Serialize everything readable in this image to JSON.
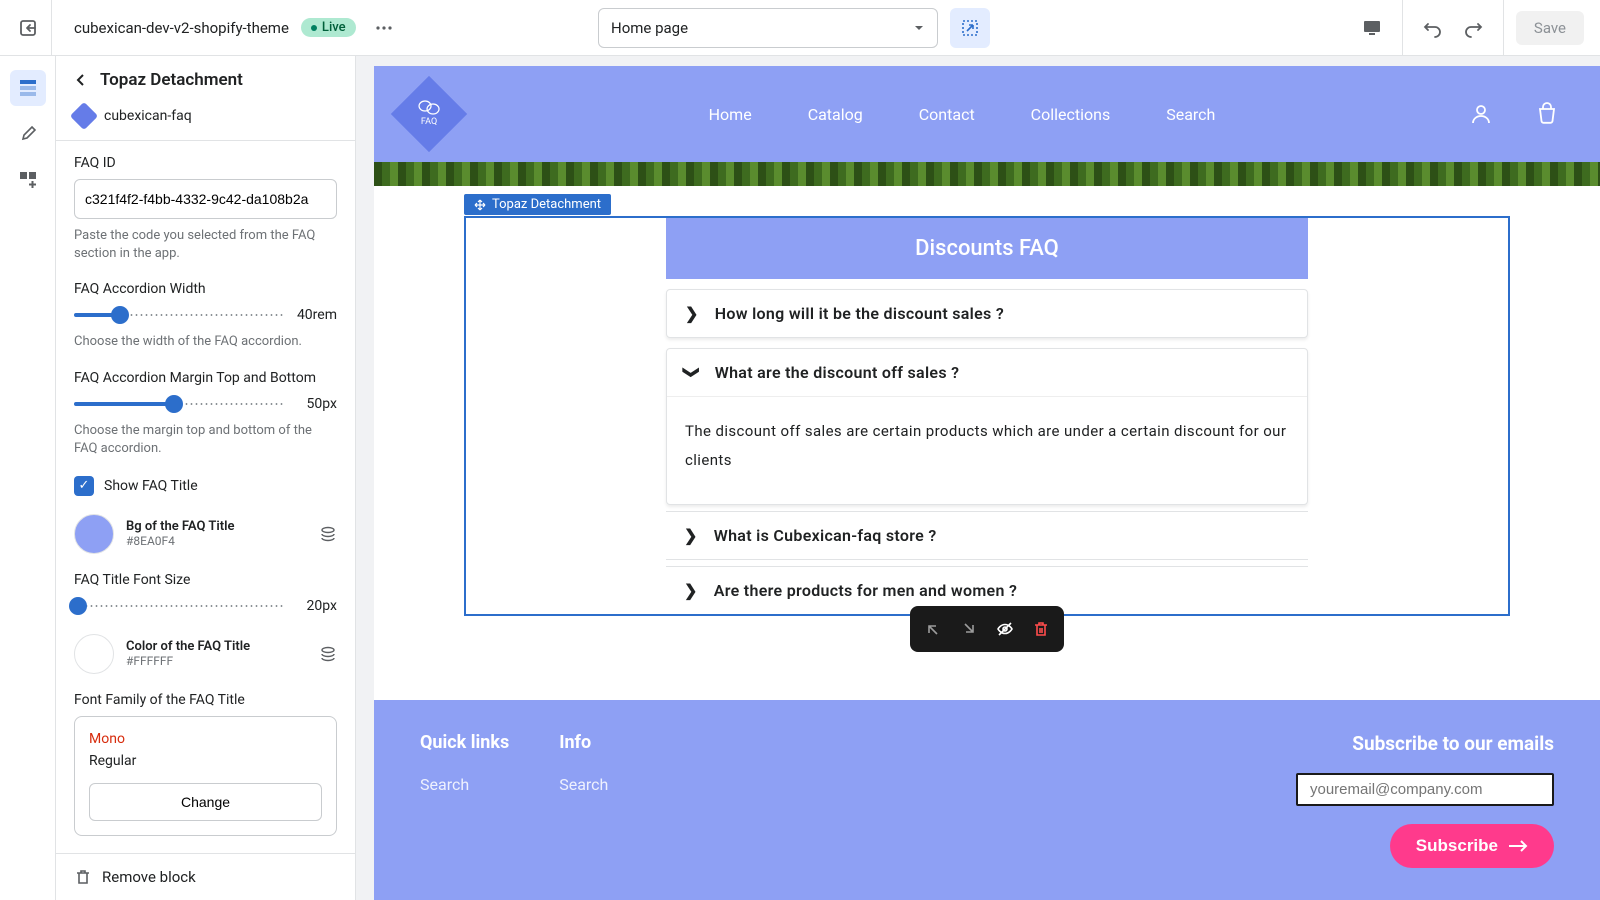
{
  "topbar": {
    "theme_name": "cubexican-dev-v2-shopify-theme",
    "live_label": "Live",
    "page_select": "Home page",
    "save_label": "Save"
  },
  "sidebar": {
    "title": "Topaz Detachment",
    "app_name": "cubexican-faq",
    "faq_id": {
      "label": "FAQ ID",
      "value": "c321f4f2-f4bb-4332-9c42-da108b2a",
      "help": "Paste the code you selected from the FAQ section in the app."
    },
    "width": {
      "label": "FAQ Accordion Width",
      "value": "40rem",
      "help": "Choose the width of the FAQ accordion."
    },
    "margin": {
      "label": "FAQ Accordion Margin Top and Bottom",
      "value": "50px",
      "help": "Choose the margin top and bottom of the FAQ accordion."
    },
    "show_title": {
      "label": "Show FAQ Title"
    },
    "bg_color": {
      "label": "Bg of the FAQ Title",
      "hex": "#8EA0F4"
    },
    "title_font_size": {
      "label": "FAQ Title Font Size",
      "value": "20px"
    },
    "title_color": {
      "label": "Color of the FAQ Title",
      "hex": "#FFFFFF"
    },
    "font_family": {
      "label": "Font Family of the FAQ Title",
      "mono": "Mono",
      "regular": "Regular",
      "change": "Change"
    },
    "remove": "Remove block"
  },
  "preview": {
    "nav": {
      "home": "Home",
      "catalog": "Catalog",
      "contact": "Contact",
      "collections": "Collections",
      "search": "Search",
      "logo_text": "FAQ"
    },
    "selection_label": "Topaz Detachment",
    "faq": {
      "title": "Discounts FAQ",
      "q1": "How long will it be the discount sales ?",
      "q2": "What are the discount off sales ?",
      "a2": "The discount off sales are certain products which are under a certain discount for our clients",
      "q3": "What is Cubexican-faq store ?",
      "q4": "Are there products for men and women ?"
    },
    "footer": {
      "quick_links": "Quick links",
      "info": "Info",
      "search": "Search",
      "subscribe_title": "Subscribe to our emails",
      "email_placeholder": "youremail@company.com",
      "subscribe_btn": "Subscribe"
    }
  }
}
